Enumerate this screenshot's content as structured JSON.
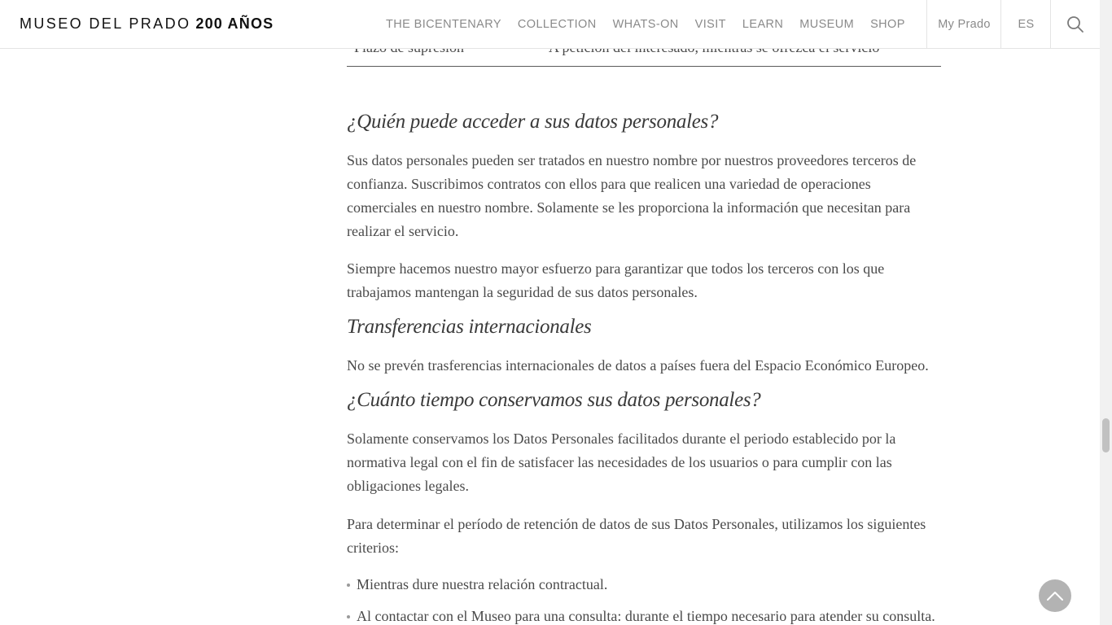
{
  "header": {
    "logo_text": "MUSEO DEL PRADO",
    "logo_bold": "200 AÑOS",
    "nav": [
      "THE BICENTENARY",
      "COLLECTION",
      "WHATS-ON",
      "VISIT",
      "LEARN",
      "MUSEUM",
      "SHOP"
    ],
    "my_prado": "My Prado",
    "language": "ES",
    "search_icon": "search-icon"
  },
  "table": {
    "label": "Plazo de supresión",
    "value": "A petición del interesado, mientras se ofrezca el servicio"
  },
  "sections": {
    "access_heading": "¿Quién puede acceder a sus datos personales?",
    "access_p1": "Sus datos personales pueden ser tratados en nuestro nombre por nuestros proveedores terceros de confianza. Suscribimos contratos con ellos para que realicen una variedad de operaciones comerciales en nuestro nombre. Solamente se les proporciona la información que necesitan para realizar el servicio.",
    "access_p2": "Siempre hacemos nuestro mayor esfuerzo para garantizar que todos los terceros con los que trabajamos mantengan la seguridad de sus datos personales.",
    "transfers_heading": "Transferencias internacionales",
    "transfers_p1": "No se prevén trasferencias internacionales de datos a países fuera del Espacio Económico Europeo.",
    "retention_heading": "¿Cuánto tiempo conservamos sus datos personales?",
    "retention_p1": "Solamente conservamos los Datos Personales facilitados durante el periodo establecido por la normativa legal con el fin de satisfacer las necesidades de los usuarios o para cumplir con las obligaciones legales.",
    "retention_p2": "Para determinar el período de retención de datos de sus Datos Personales, utilizamos los siguientes criterios:",
    "criteria": [
      "Mientras dure nuestra relación contractual.",
      "Al contactar con el Museo para una consulta: durante el tiempo necesario para atender su consulta."
    ]
  },
  "back_to_top_icon": "chevron-up-icon",
  "colors": {
    "text": "#4a4a4a",
    "heading": "#3a3a3a",
    "nav": "#8a8a8a",
    "logo": "#111111",
    "back_to_top": "#b3b3b3"
  }
}
